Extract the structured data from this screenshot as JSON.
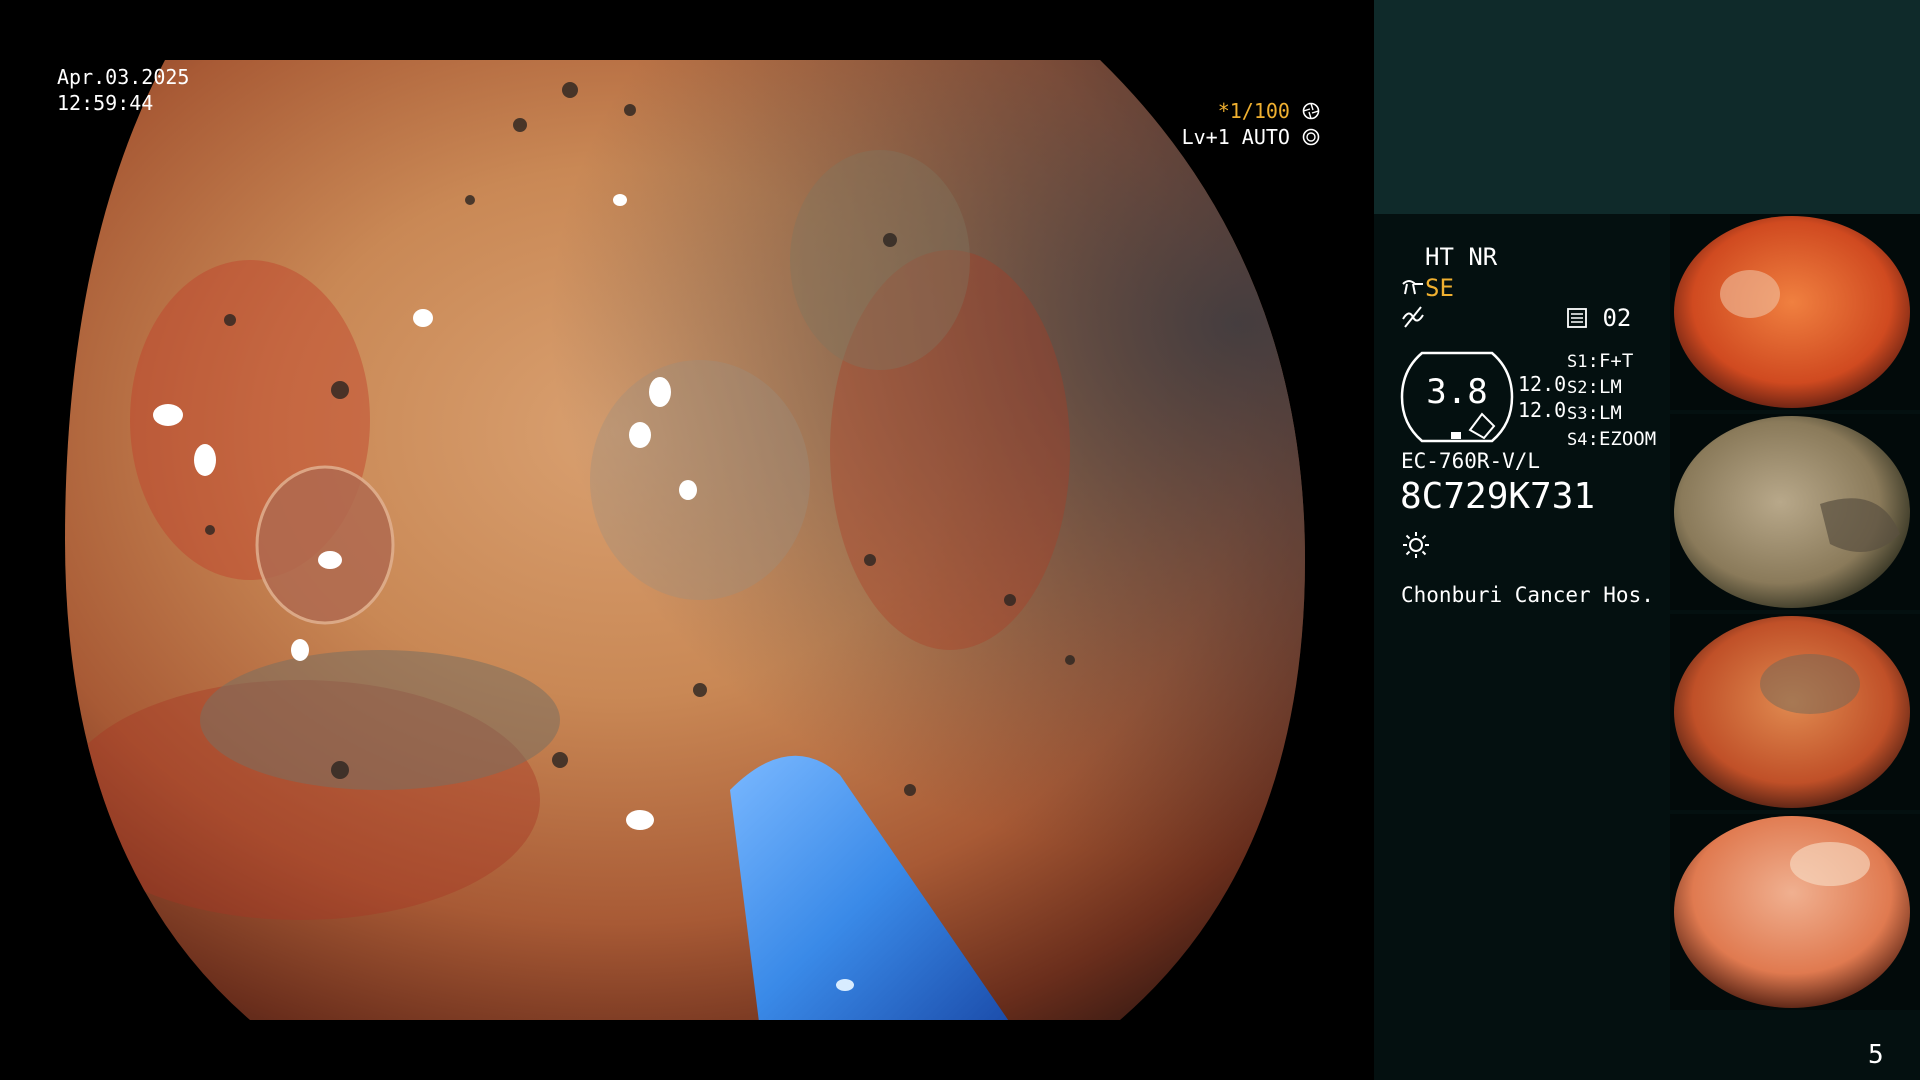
{
  "overlay": {
    "date": "Apr.03.2025",
    "time": "12:59:44",
    "shutter": "*1/100",
    "level_auto": "Lv+1 AUTO"
  },
  "panel": {
    "ht_nr": "HT NR",
    "se": "SE",
    "memory_slot": "02",
    "zoom_value": "3.8",
    "gain_1": "12.0",
    "gain_2": "12.0",
    "switches": [
      {
        "key": "S1",
        "value": "F+T"
      },
      {
        "key": "S2",
        "value": "LM"
      },
      {
        "key": "S3",
        "value": "LM"
      },
      {
        "key": "S4",
        "value": "EZOOM"
      }
    ],
    "scope_model": "EC-760R-V/L",
    "serial": "8C729K731",
    "hospital": "Chonburi Cancer Hos.",
    "page_number": "5"
  },
  "icons": {
    "shutter_icon": "aperture-icon",
    "auto_icon": "iris-icon",
    "se_icon": "structure-enhance-icon",
    "wave_icon": "no-signal-icon",
    "memory_icon": "memory-icon",
    "light_icon": "light-icon"
  },
  "colors": {
    "accent_yellow": "#f0b030",
    "panel_top": "#0f2a2a",
    "panel_bg": "#041010"
  }
}
